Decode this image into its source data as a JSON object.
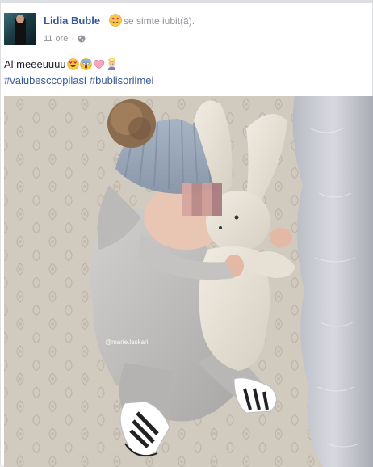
{
  "post": {
    "author": "Lidia Buble",
    "feeling": "se simte iubit(ă).",
    "feeling_emoji": "in-love-face-icon",
    "timestamp": "11 ore",
    "separator": "·",
    "privacy_icon": "globe-icon",
    "message": "Al meeeuuuu",
    "message_emojis": [
      "heart-eyes-emoji",
      "screaming-face-emoji",
      "pink-heart-emoji",
      "baby-angel-emoji"
    ],
    "hashtags": [
      "#vaiubesccopilasi",
      "#bublisoriimei"
    ],
    "photo": {
      "watermark": "@marie.laskari"
    }
  },
  "colors": {
    "link": "#365899",
    "meta": "#90949c",
    "text": "#1d2129"
  }
}
